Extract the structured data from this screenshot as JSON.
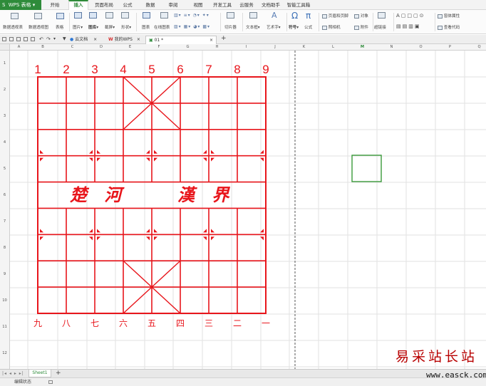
{
  "app": {
    "name": "WPS 表格"
  },
  "menu_tabs": [
    "开始",
    "插入",
    "页面布局",
    "公式",
    "数据",
    "审阅",
    "视图",
    "开发工具",
    "云服务",
    "文档助手",
    "智能工具箱"
  ],
  "active_menu_tab": "插入",
  "ribbon": {
    "pivot_table": "数据透视表",
    "pivot_chart": "数据透视图",
    "table": "表格",
    "picture": "图片",
    "gallery": "图库",
    "screenshot": "截屏",
    "shapes": "形状",
    "chart": "图表",
    "sparkline": "在线图表",
    "slicer": "切片器",
    "textbox": "文本框",
    "wordart": "艺术字",
    "symbol": "符号",
    "formula": "公式",
    "header_footer": "页眉和页脚",
    "camera": "照相机",
    "object": "对象",
    "attachment": "附件",
    "hyperlink": "超链接",
    "properties": "窗体属性",
    "code": "查看代码"
  },
  "doc_tabs": {
    "cloud": "云文档",
    "mywps": "我的WPS",
    "active": "01 *"
  },
  "columns": [
    "A",
    "B",
    "C",
    "D",
    "E",
    "F",
    "G",
    "H",
    "I",
    "J",
    "K",
    "L",
    "M",
    "N",
    "O",
    "P",
    "Q"
  ],
  "rows": [
    "1",
    "2",
    "3",
    "4",
    "5",
    "6",
    "7",
    "8",
    "9",
    "10",
    "11",
    "12"
  ],
  "board": {
    "top_labels": [
      "1",
      "2",
      "3",
      "4",
      "5",
      "6",
      "7",
      "8",
      "9"
    ],
    "bottom_labels": [
      "九",
      "八",
      "七",
      "六",
      "五",
      "四",
      "三",
      "二",
      "一"
    ],
    "river_left": "楚 河",
    "river_right": "漢 界",
    "line_color": "#e8151b"
  },
  "sheet_tab": "Sheet1",
  "status": "编辑状态",
  "watermark": {
    "text": "易采站长站",
    "url": "www.easck.com"
  },
  "colors": {
    "accent": "#2e8b3a",
    "selected_cell": "#3a9a3a"
  }
}
